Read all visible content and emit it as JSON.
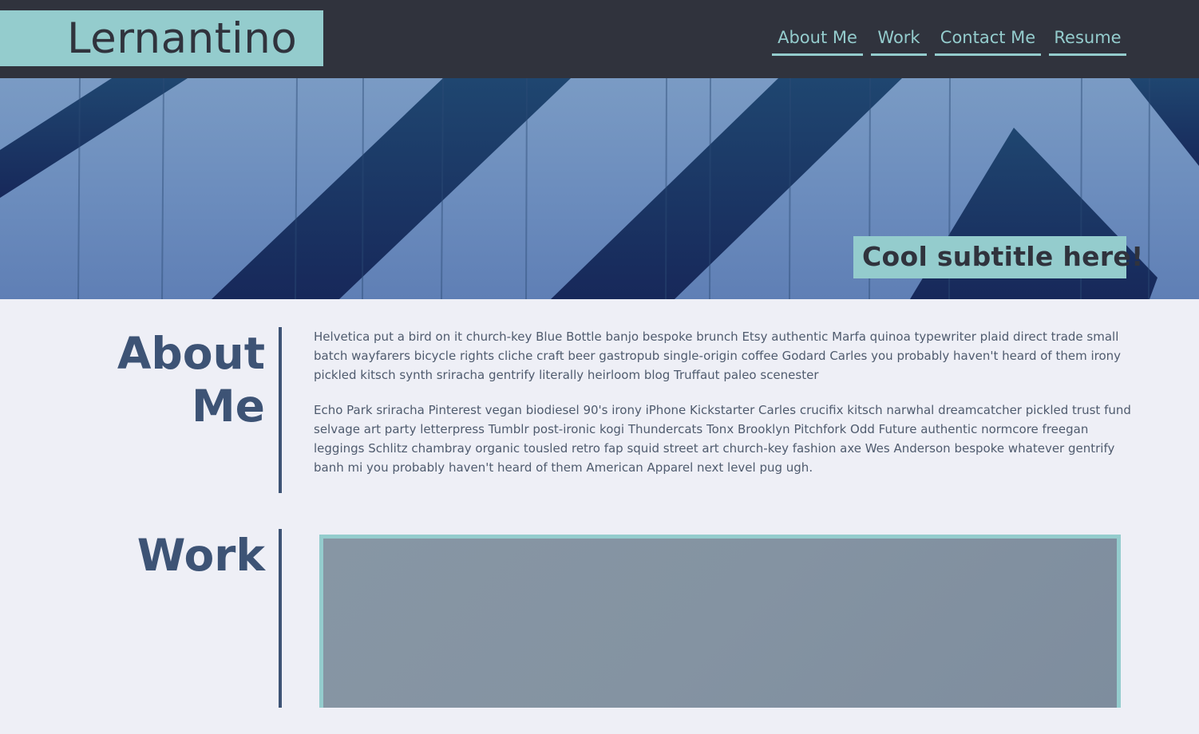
{
  "header": {
    "logo_text": "Lernantino",
    "nav": [
      {
        "label": "About Me"
      },
      {
        "label": "Work"
      },
      {
        "label": "Contact Me"
      },
      {
        "label": "Resume"
      }
    ]
  },
  "hero": {
    "subtitle": "Cool subtitle here!"
  },
  "about": {
    "title_line1": "About",
    "title_line2": "Me",
    "paragraphs": [
      "Helvetica put a bird on it church-key Blue Bottle banjo bespoke brunch Etsy authentic Marfa quinoa typewriter plaid direct trade small batch wayfarers bicycle rights cliche craft beer gastropub single-origin coffee Godard Carles you probably haven't heard of them irony pickled kitsch synth sriracha gentrify literally heirloom blog Truffaut paleo scenester",
      "Echo Park sriracha Pinterest vegan biodiesel 90's irony iPhone Kickstarter Carles crucifix kitsch narwhal dreamcatcher pickled trust fund selvage art party letterpress Tumblr post-ironic kogi Thundercats Tonx Brooklyn Pitchfork Odd Future authentic normcore freegan leggings Schlitz chambray organic tousled retro fap squid street art church-key fashion axe Wes Anderson bespoke whatever gentrify banh mi you probably haven't heard of them American Apparel next level pug ugh."
    ]
  },
  "work": {
    "title": "Work"
  },
  "colors": {
    "header_bg": "#30333d",
    "accent": "#94cccd",
    "section_title": "#3d5375",
    "body_bg": "#eeeff6",
    "body_text": "#4f5b6e"
  }
}
